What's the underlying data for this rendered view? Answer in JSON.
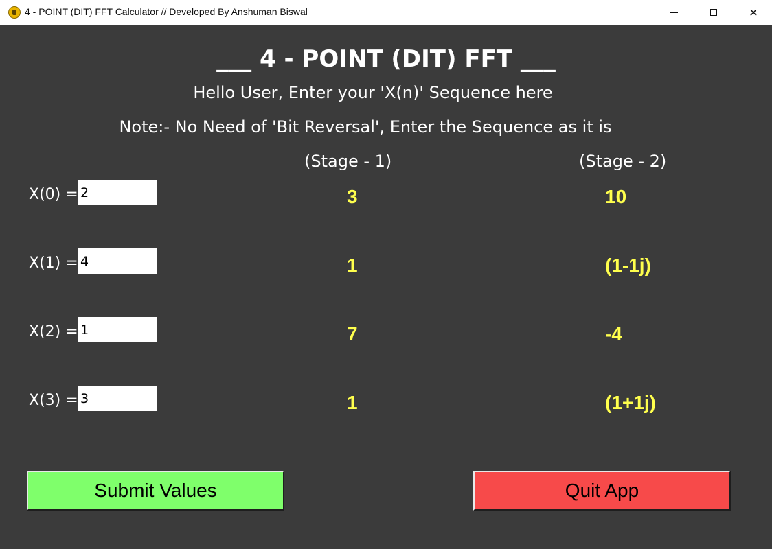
{
  "window": {
    "title": "4 - POINT (DIT) FFT Calculator // Developed By Anshuman Biswal",
    "controls": {
      "minimize": "—",
      "maximize": "☐",
      "close": "✕"
    }
  },
  "header": {
    "title": "___ 4 - POINT (DIT) FFT ___",
    "subtitle": "Hello User, Enter your 'X(n)' Sequence here",
    "note": "Note:- No Need of  'Bit Reversal', Enter the Sequence as it is"
  },
  "stages": {
    "stage1": "(Stage - 1)",
    "stage2": "(Stage - 2)"
  },
  "rows": [
    {
      "label": "X(0) =",
      "value": "2",
      "stage1": "3",
      "stage2": "10"
    },
    {
      "label": "X(1) =",
      "value": "4",
      "stage1": "1",
      "stage2": "(1-1j)"
    },
    {
      "label": "X(2) =",
      "value": "1",
      "stage1": "7",
      "stage2": "-4"
    },
    {
      "label": "X(3) =",
      "value": "3",
      "stage1": "1",
      "stage2": "(1+1j)"
    }
  ],
  "buttons": {
    "submit": "Submit Values",
    "quit": "Quit App"
  },
  "colors": {
    "background": "#3b3b3b",
    "result_text": "#ffff4d",
    "submit_bg": "#7fff6b",
    "quit_bg": "#f74a4a"
  }
}
